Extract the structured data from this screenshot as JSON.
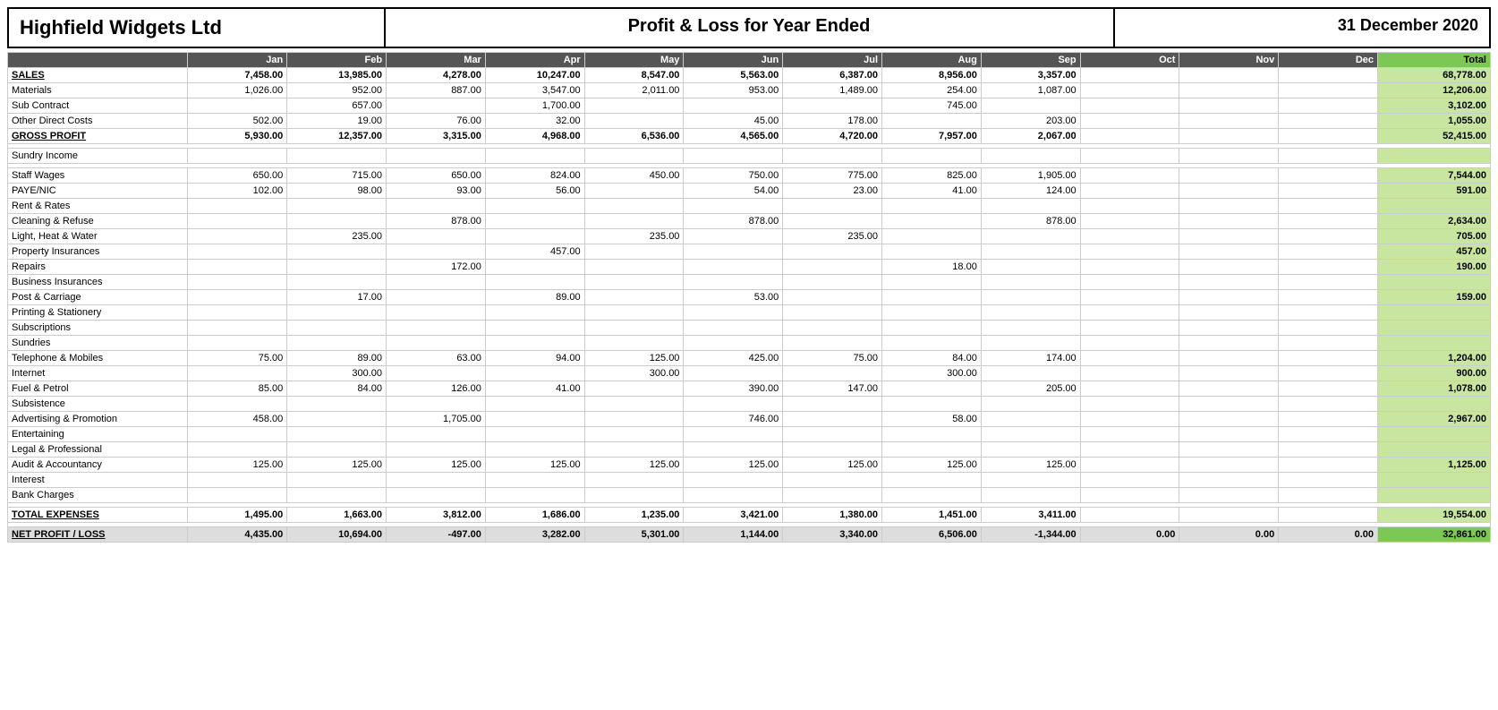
{
  "company": "Highfield Widgets Ltd",
  "report_title": "Profit & Loss for Year Ended",
  "report_date": "31 December 2020",
  "columns": [
    "Jan",
    "Feb",
    "Mar",
    "Apr",
    "May",
    "Jun",
    "Jul",
    "Aug",
    "Sep",
    "Oct",
    "Nov",
    "Dec",
    "Total"
  ],
  "rows": [
    {
      "type": "header-sales",
      "label": "SALES",
      "values": [
        "7,458.00",
        "13,985.00",
        "4,278.00",
        "10,247.00",
        "8,547.00",
        "5,563.00",
        "6,387.00",
        "8,956.00",
        "3,357.00",
        "",
        "",
        "",
        "68,778.00"
      ]
    },
    {
      "type": "data",
      "label": "Materials",
      "values": [
        "1,026.00",
        "952.00",
        "887.00",
        "3,547.00",
        "2,011.00",
        "953.00",
        "1,489.00",
        "254.00",
        "1,087.00",
        "",
        "",
        "",
        "12,206.00"
      ]
    },
    {
      "type": "data",
      "label": "Sub Contract",
      "values": [
        "",
        "657.00",
        "",
        "1,700.00",
        "",
        "",
        "",
        "745.00",
        "",
        "",
        "",
        "",
        "3,102.00"
      ]
    },
    {
      "type": "data",
      "label": "Other Direct Costs",
      "values": [
        "502.00",
        "19.00",
        "76.00",
        "32.00",
        "",
        "45.00",
        "178.00",
        "",
        "203.00",
        "",
        "",
        "",
        "1,055.00"
      ]
    },
    {
      "type": "header-gross",
      "label": "GROSS PROFIT",
      "values": [
        "5,930.00",
        "12,357.00",
        "3,315.00",
        "4,968.00",
        "6,536.00",
        "4,565.00",
        "4,720.00",
        "7,957.00",
        "2,067.00",
        "",
        "",
        "",
        "52,415.00"
      ]
    },
    {
      "type": "spacer"
    },
    {
      "type": "data",
      "label": "Sundry Income",
      "values": [
        "",
        "",
        "",
        "",
        "",
        "",
        "",
        "",
        "",
        "",
        "",
        "",
        ""
      ]
    },
    {
      "type": "spacer"
    },
    {
      "type": "data",
      "label": "Staff Wages",
      "values": [
        "650.00",
        "715.00",
        "650.00",
        "824.00",
        "450.00",
        "750.00",
        "775.00",
        "825.00",
        "1,905.00",
        "",
        "",
        "",
        "7,544.00"
      ]
    },
    {
      "type": "data",
      "label": "PAYE/NIC",
      "values": [
        "102.00",
        "98.00",
        "93.00",
        "56.00",
        "",
        "54.00",
        "23.00",
        "41.00",
        "124.00",
        "",
        "",
        "",
        "591.00"
      ]
    },
    {
      "type": "data",
      "label": "Rent & Rates",
      "values": [
        "",
        "",
        "",
        "",
        "",
        "",
        "",
        "",
        "",
        "",
        "",
        "",
        ""
      ]
    },
    {
      "type": "data",
      "label": "Cleaning & Refuse",
      "values": [
        "",
        "",
        "878.00",
        "",
        "",
        "878.00",
        "",
        "",
        "878.00",
        "",
        "",
        "",
        "2,634.00"
      ]
    },
    {
      "type": "data",
      "label": "Light, Heat & Water",
      "values": [
        "",
        "235.00",
        "",
        "",
        "235.00",
        "",
        "235.00",
        "",
        "",
        "",
        "",
        "",
        "705.00"
      ]
    },
    {
      "type": "data",
      "label": "Property Insurances",
      "values": [
        "",
        "",
        "",
        "457.00",
        "",
        "",
        "",
        "",
        "",
        "",
        "",
        "",
        "457.00"
      ]
    },
    {
      "type": "data",
      "label": "Repairs",
      "values": [
        "",
        "",
        "172.00",
        "",
        "",
        "",
        "",
        "18.00",
        "",
        "",
        "",
        "",
        "190.00"
      ]
    },
    {
      "type": "data",
      "label": "Business Insurances",
      "values": [
        "",
        "",
        "",
        "",
        "",
        "",
        "",
        "",
        "",
        "",
        "",
        "",
        ""
      ]
    },
    {
      "type": "data",
      "label": "Post & Carriage",
      "values": [
        "",
        "17.00",
        "",
        "89.00",
        "",
        "53.00",
        "",
        "",
        "",
        "",
        "",
        "",
        "159.00"
      ]
    },
    {
      "type": "data",
      "label": "Printing & Stationery",
      "values": [
        "",
        "",
        "",
        "",
        "",
        "",
        "",
        "",
        "",
        "",
        "",
        "",
        ""
      ]
    },
    {
      "type": "data",
      "label": "Subscriptions",
      "values": [
        "",
        "",
        "",
        "",
        "",
        "",
        "",
        "",
        "",
        "",
        "",
        "",
        ""
      ]
    },
    {
      "type": "data",
      "label": "Sundries",
      "values": [
        "",
        "",
        "",
        "",
        "",
        "",
        "",
        "",
        "",
        "",
        "",
        "",
        ""
      ]
    },
    {
      "type": "data",
      "label": "Telephone & Mobiles",
      "values": [
        "75.00",
        "89.00",
        "63.00",
        "94.00",
        "125.00",
        "425.00",
        "75.00",
        "84.00",
        "174.00",
        "",
        "",
        "",
        "1,204.00"
      ]
    },
    {
      "type": "data",
      "label": "Internet",
      "values": [
        "",
        "300.00",
        "",
        "",
        "300.00",
        "",
        "",
        "300.00",
        "",
        "",
        "",
        "",
        "900.00"
      ]
    },
    {
      "type": "data",
      "label": "Fuel & Petrol",
      "values": [
        "85.00",
        "84.00",
        "126.00",
        "41.00",
        "",
        "390.00",
        "147.00",
        "",
        "205.00",
        "",
        "",
        "",
        "1,078.00"
      ]
    },
    {
      "type": "data",
      "label": "Subsistence",
      "values": [
        "",
        "",
        "",
        "",
        "",
        "",
        "",
        "",
        "",
        "",
        "",
        "",
        ""
      ]
    },
    {
      "type": "data",
      "label": "Advertising & Promotion",
      "values": [
        "458.00",
        "",
        "1,705.00",
        "",
        "",
        "746.00",
        "",
        "58.00",
        "",
        "",
        "",
        "",
        "2,967.00"
      ]
    },
    {
      "type": "data",
      "label": "Entertaining",
      "values": [
        "",
        "",
        "",
        "",
        "",
        "",
        "",
        "",
        "",
        "",
        "",
        "",
        ""
      ]
    },
    {
      "type": "data",
      "label": "Legal & Professional",
      "values": [
        "",
        "",
        "",
        "",
        "",
        "",
        "",
        "",
        "",
        "",
        "",
        "",
        ""
      ]
    },
    {
      "type": "data",
      "label": "Audit & Accountancy",
      "values": [
        "125.00",
        "125.00",
        "125.00",
        "125.00",
        "125.00",
        "125.00",
        "125.00",
        "125.00",
        "125.00",
        "",
        "",
        "",
        "1,125.00"
      ]
    },
    {
      "type": "data",
      "label": "Interest",
      "values": [
        "",
        "",
        "",
        "",
        "",
        "",
        "",
        "",
        "",
        "",
        "",
        "",
        ""
      ]
    },
    {
      "type": "data",
      "label": "Bank Charges",
      "values": [
        "",
        "",
        "",
        "",
        "",
        "",
        "",
        "",
        "",
        "",
        "",
        "",
        ""
      ]
    },
    {
      "type": "spacer"
    },
    {
      "type": "header-total-exp",
      "label": "TOTAL EXPENSES",
      "values": [
        "1,495.00",
        "1,663.00",
        "3,812.00",
        "1,686.00",
        "1,235.00",
        "3,421.00",
        "1,380.00",
        "1,451.00",
        "3,411.00",
        "",
        "",
        "",
        "19,554.00"
      ]
    },
    {
      "type": "spacer"
    },
    {
      "type": "header-net",
      "label": "NET PROFIT / LOSS",
      "values": [
        "4,435.00",
        "10,694.00",
        "-497.00",
        "3,282.00",
        "5,301.00",
        "1,144.00",
        "3,340.00",
        "6,506.00",
        "-1,344.00",
        "0.00",
        "0.00",
        "0.00",
        "32,861.00"
      ]
    }
  ]
}
